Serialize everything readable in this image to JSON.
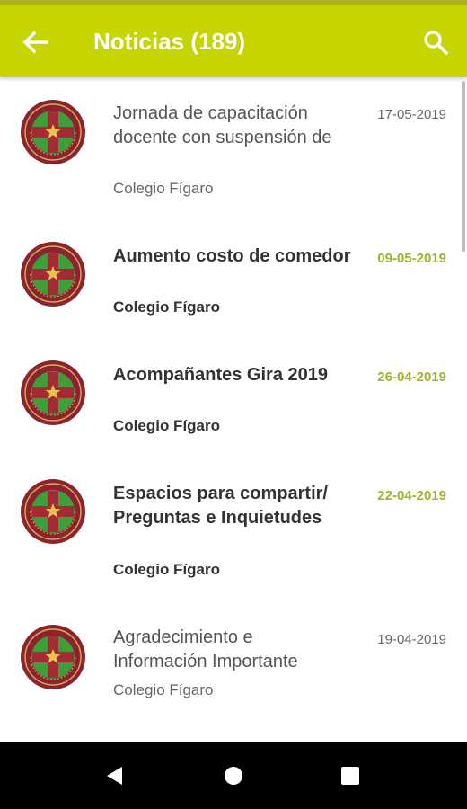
{
  "appbar": {
    "title": "Noticias (189)",
    "back_icon": "arrow-left-icon",
    "search_icon": "search-icon",
    "color": "#c6d400"
  },
  "news": [
    {
      "title": "Jornada de capacitación docente con suspensión de",
      "source": "Colegio Fígaro",
      "date": "17-05-2019",
      "unread": false
    },
    {
      "title": "Aumento costo de comedor",
      "source": "Colegio Fígaro",
      "date": "09-05-2019",
      "unread": true
    },
    {
      "title": "Acompañantes Gira 2019",
      "source": "Colegio Fígaro",
      "date": "26-04-2019",
      "unread": true
    },
    {
      "title": "Espacios para compartir/ Preguntas e Inquietudes",
      "source": "Colegio Fígaro",
      "date": "22-04-2019",
      "unread": true
    },
    {
      "title": "Agradecimiento e Información Importante",
      "source": "Colegio Fígaro",
      "date": "19-04-2019",
      "unread": false
    }
  ],
  "navbar": {
    "back_icon": "triangle-back-icon",
    "home_icon": "circle-home-icon",
    "recents_icon": "square-recents-icon"
  },
  "colors": {
    "accent_date": "#a4b12a",
    "crest_maroon": "#8b2332",
    "crest_green": "#3f9e3a",
    "crest_gold": "#d8b24a"
  }
}
